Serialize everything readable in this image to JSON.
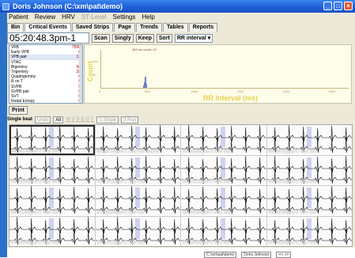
{
  "window": {
    "title": "Doris Johnson (C:\\xm\\pat\\demo)"
  },
  "menu": [
    "Patient",
    "Review",
    "HRV",
    "ST-Level",
    "Settings",
    "Help"
  ],
  "menu_disabled": [
    false,
    false,
    false,
    true,
    false,
    false
  ],
  "tabs": [
    "Bin",
    "Critical Events",
    "Saved Strips",
    "Page",
    "Trends",
    "Tables",
    "Reports"
  ],
  "active_tab": 1,
  "toolbar": {
    "time": "05:20:48.3pm-1",
    "scan": "Scan",
    "singly": "Singly",
    "keep": "Keep",
    "sort": "Sort",
    "sort_select": "RR interval ▾"
  },
  "events": [
    {
      "name": "VFB",
      "count": "7698"
    },
    {
      "name": "Early VPB",
      "count": "0"
    },
    {
      "name": "VPB pair",
      "count": "13"
    },
    {
      "name": "VTAC",
      "count": "1"
    },
    {
      "name": "Bigeminy",
      "count": "50"
    },
    {
      "name": "Trigeminy",
      "count": "28"
    },
    {
      "name": "Quadrigeminy",
      "count": "0"
    },
    {
      "name": "R on T",
      "count": "0"
    },
    {
      "name": "SVPB",
      "count": "5"
    },
    {
      "name": "SVPB pair",
      "count": "0"
    },
    {
      "name": "SVT",
      "count": "0"
    },
    {
      "name": "Nodal Ectopy",
      "count": "0"
    }
  ],
  "chart": {
    "ylabel": "Count",
    "xlabel": "RR Interval (ms)",
    "annotation": "483 ms count: 13",
    "yticks": [
      "100",
      "50"
    ],
    "xticks": [
      "0",
      "500",
      "1000",
      "1500",
      "2000",
      "2500"
    ]
  },
  "chart_data": {
    "type": "bar",
    "xlabel": "RR Interval (ms)",
    "ylabel": "Count",
    "x": [
      466,
      472,
      478,
      483,
      489,
      494,
      499,
      502
    ],
    "values": [
      3,
      6,
      10,
      13,
      13,
      9,
      5,
      2
    ],
    "xlim": [
      0,
      2700
    ],
    "ylim": [
      0,
      140
    ]
  },
  "print_label": "Print",
  "beatbar": {
    "label": "Single beat",
    "undo": "Undo",
    "all": "All",
    "letters": [
      "N",
      "V",
      "S",
      "E",
      "U",
      "T"
    ],
    "single": "1 Single",
    "run": "3 Run"
  },
  "strips": [
    {
      "label": "05:20:48pm-1   472 ms"
    },
    {
      "label": "06:46:18pm-1   478 ms   saved"
    },
    {
      "label": "07:26:52pm-1   478 ms"
    },
    {
      "label": "05:20:52pm-1   483 ms"
    },
    {
      "label": "06:20:55pm-1   483 ms"
    },
    {
      "label": "06:12:18pm-1   483 ms"
    },
    {
      "label": "06:26:22pm-1   489 ms"
    },
    {
      "label": "06:56:36pm-1   489 ms"
    },
    {
      "label": "06:21:00pm-1   489 ms"
    },
    {
      "label": "07:55:09pm-1   489 ms"
    },
    {
      "label": "05:40:09pm-1   494 ms"
    },
    {
      "label": "06:20:59pm-1   494 ms"
    },
    {
      "label": "07:00:09pm-1   499 ms"
    },
    {
      "label": "06:12:21pm-1   499 ms"
    },
    {
      "label": "07:26:55pm-1   494 ms"
    },
    {
      "label": "07:35:58pm-1   494 ms"
    }
  ],
  "status": {
    "path": "C:\\xm\\pat\\demo",
    "patient": "Doris Johnson",
    "nav": "<< >>"
  },
  "colors": {
    "titlebar": "#1c5dd6",
    "accent_blue": "#2b71c9",
    "chart_bg": "#fdfde9",
    "chart_label": "#e8d14a",
    "histogram_bar": "#6b7fcc",
    "ecg_trace": "#111111",
    "highlight_beat": "#7f86d6"
  }
}
